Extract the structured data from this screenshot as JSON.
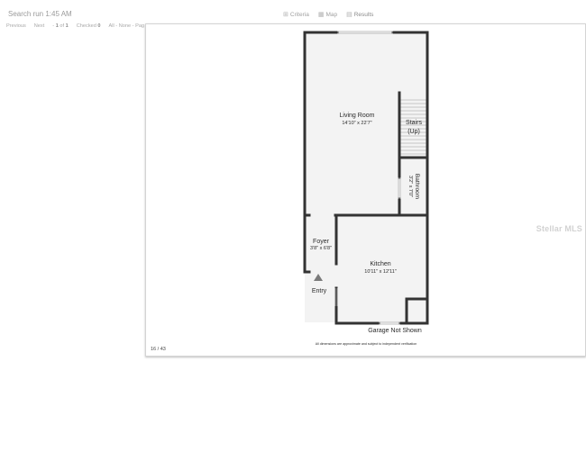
{
  "header": {
    "search_run": "Search run 1:45 AM"
  },
  "view_tabs": [
    {
      "icon": "grid-icon",
      "label": "Criteria"
    },
    {
      "icon": "map-icon",
      "label": "Map"
    },
    {
      "icon": "results-icon",
      "label": "Results"
    }
  ],
  "nav": {
    "previous": "Previous",
    "next": "Next",
    "position_prefix": "-",
    "position": "1",
    "position_of": "of",
    "total": "1",
    "checked_label": "Checked",
    "checked_count": "0",
    "select_prefix": "All -",
    "select_none": "None -",
    "select_page": "Pag"
  },
  "viewer": {
    "counter": "16 / 43",
    "watermark": "Stellar MLS",
    "disclaimer": "All dimensions are approximate and subject to independent verification"
  },
  "floorplan": {
    "living_room": {
      "name": "Living Room",
      "dims": "14'10\" x 22'7\""
    },
    "stairs": {
      "name": "Stairs",
      "note": "(Up)"
    },
    "bathroom": {
      "name": "Bathroom",
      "dims": "3'2\" x 7'0\""
    },
    "foyer": {
      "name": "Foyer",
      "dims": "3'8\" x 6'8\""
    },
    "kitchen": {
      "name": "Kitchen",
      "dims": "10'11\" x 12'11\""
    },
    "entry": "Entry",
    "garage": "Garage Not Shown"
  },
  "colors": {
    "wall": "#333333",
    "floor": "#f3f3f3"
  }
}
